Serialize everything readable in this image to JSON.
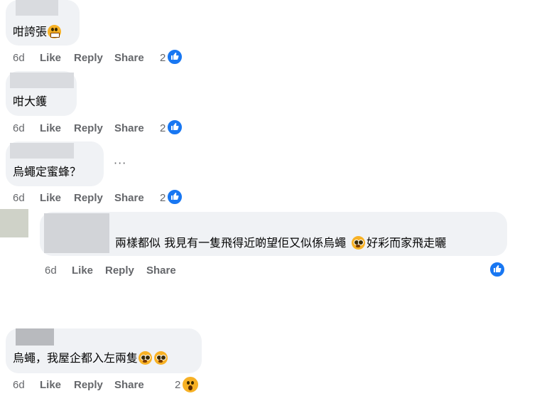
{
  "comments": [
    {
      "text": "咁誇張",
      "time": "6d",
      "like": "Like",
      "reply": "Reply",
      "share": "Share",
      "count": "2",
      "reaction": "like-icon",
      "emoji": [
        "grinning-emoji"
      ]
    },
    {
      "text": "咁大鑊",
      "time": "6d",
      "like": "Like",
      "reply": "Reply",
      "share": "Share",
      "count": "2",
      "reaction": "like-icon",
      "emoji": []
    },
    {
      "text": "烏蠅定蜜蜂？",
      "time": "6d",
      "like": "Like",
      "reply": "Reply",
      "share": "Share",
      "count": "2",
      "reaction": "like-icon",
      "emoji": [],
      "more": "···"
    },
    {
      "text_a": "兩樣都似 我見有一隻飛得近啲望佢又似係烏蠅",
      "text_b": "好彩而家飛走曬",
      "time": "6d",
      "like": "Like",
      "reply": "Reply",
      "share": "Share",
      "count": "",
      "reaction": "like-icon",
      "emoji": [
        "flushed-emoji"
      ]
    },
    {
      "text": "烏蠅，我屋企都入左兩隻",
      "time": "6d",
      "like": "Like",
      "reply": "Reply",
      "share": "Share",
      "count": "2",
      "reaction": "wow-icon",
      "emoji": [
        "flushed-emoji",
        "flushed-emoji"
      ]
    }
  ],
  "colors": {
    "bubble": "#f0f2f5",
    "action": "#65676b",
    "like_blue": "#1877f2",
    "emoji_yellow": "#f7b125"
  }
}
